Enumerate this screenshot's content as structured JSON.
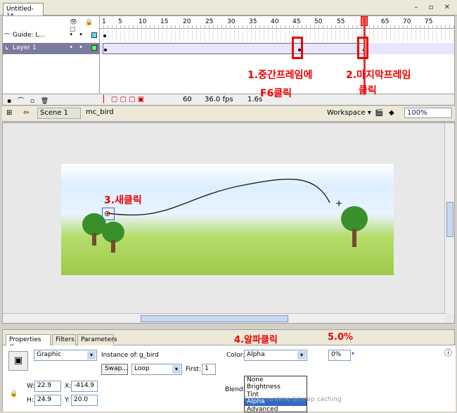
{
  "document": {
    "tab_label": "Untitled-1*"
  },
  "timeline": {
    "layers": [
      {
        "name": "Guide: L...",
        "type": "guide"
      },
      {
        "name": "Layer 1",
        "type": "normal",
        "selected": true
      }
    ],
    "ruler_numbers": [
      "1",
      "5",
      "10",
      "15",
      "20",
      "25",
      "30",
      "35",
      "40",
      "45",
      "50",
      "55",
      "60",
      "65",
      "70",
      "75"
    ],
    "status": {
      "current_frame": "60",
      "fps": "36.0 fps",
      "time": "1.6s"
    }
  },
  "annotations": {
    "step1_line1": "1.중간프레임에",
    "step1_line2": "F6클릭",
    "step2_line1": "2.마지막프레임",
    "step2_line2": "클릭",
    "step3": "3.새클릭",
    "step4": "4.알파클릭",
    "step5": "5.0%"
  },
  "editbar": {
    "scene_label": "Scene 1",
    "symbol_label": "mc_bird",
    "workspace_label": "Workspace",
    "zoom_value": "100%"
  },
  "properties": {
    "tabs": [
      "Properties",
      "Filters",
      "Parameters"
    ],
    "symbol_type": "Graphic",
    "instance_of_label": "Instance of:",
    "instance_of_value": "g_bird",
    "swap_label": "Swap...",
    "loop_value": "Loop",
    "first_label": "First:",
    "first_value": "1",
    "color_label": "Color:",
    "color_value": "Alpha",
    "color_options": [
      "None",
      "Brightness",
      "Tint",
      "Alpha",
      "Advanced"
    ],
    "alpha_value": "0%",
    "blend_label": "Blend:",
    "cache_label": "Use runtime bitmap caching",
    "w_label": "W:",
    "w_value": "22.9",
    "h_label": "H:",
    "h_value": "24.9",
    "x_label": "X:",
    "x_value": "-414.9",
    "y_label": "Y:",
    "y_value": "20.0"
  },
  "colors": {
    "annotation": "#e00000",
    "selection": "#316ac5"
  }
}
